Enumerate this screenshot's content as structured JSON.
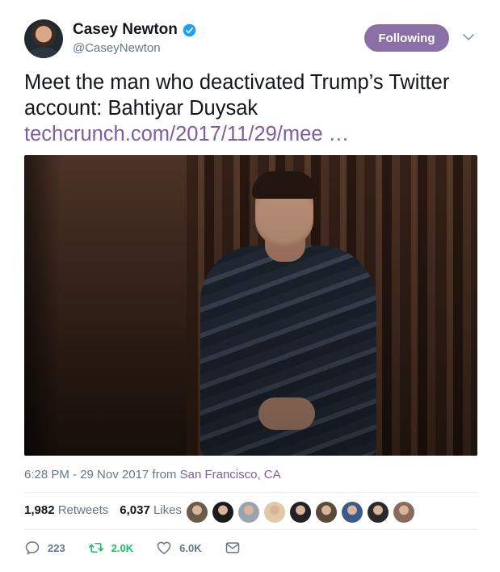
{
  "author": {
    "name": "Casey Newton",
    "handle": "@CaseyNewton",
    "avatar_icon": "user-avatar",
    "verified_icon": "verified-badge-icon",
    "verified_color": "#1da1f2"
  },
  "follow_button": {
    "label": "Following",
    "color": "#8b70a8"
  },
  "tweet": {
    "text": "Meet the man who deactivated Trump’s Twitter account: Bahtiyar Duysak",
    "link": "techcrunch.com/2017/11/29/mee …",
    "link_color": "#7d5d9e"
  },
  "meta": {
    "timestamp": "6:28 PM - 29 Nov 2017 from ",
    "location": "San Francisco, CA"
  },
  "stats": {
    "retweets_count": "1,982",
    "retweets_label": "Retweets",
    "likes_count": "6,037",
    "likes_label": "Likes"
  },
  "likers": [
    {
      "color": "#6b5b4a"
    },
    {
      "color": "#1b1b1b"
    },
    {
      "color": "#9aa4ad"
    },
    {
      "color": "#e2c9a6"
    },
    {
      "color": "#222222"
    },
    {
      "color": "#5a4a3a"
    },
    {
      "color": "#3c5a8a"
    },
    {
      "color": "#2a2a2a"
    },
    {
      "color": "#8a6a5a"
    }
  ],
  "actions": {
    "replies": "223",
    "retweets": "2.0K",
    "likes": "6.0K"
  }
}
